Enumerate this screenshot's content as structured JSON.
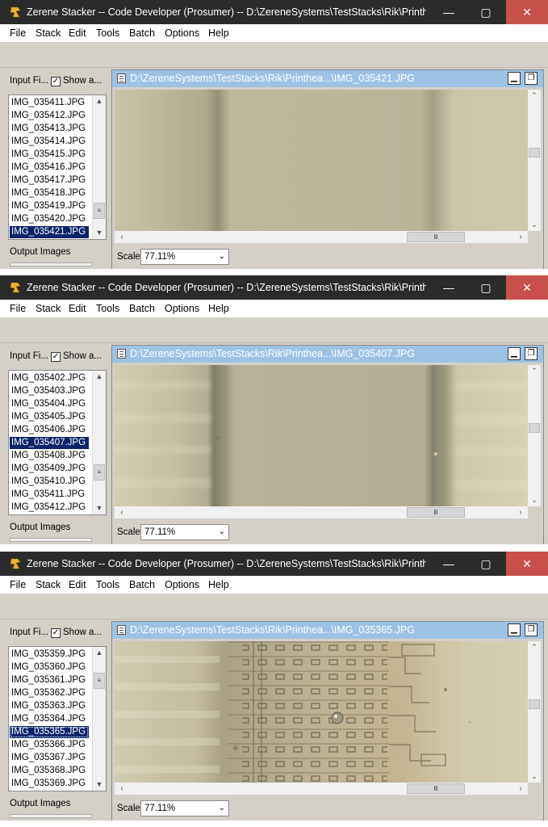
{
  "window_title": "Zerene Stacker -- Code Developer (Prosumer) -- D:\\ZereneSystems\\TestStacks\\Rik\\Printhea......",
  "window_controls": {
    "minimize": "—",
    "maximize": "▢",
    "close": "✕"
  },
  "menu": [
    "File",
    "Stack",
    "Edit",
    "Tools",
    "Batch",
    "Options",
    "Help"
  ],
  "panel": {
    "input_files_label": "Input Fi...",
    "show_all_label": "Show a...",
    "show_all_checked": true,
    "output_images_label": "Output Images",
    "scale_label": "Scale",
    "scale_value": "77.11%"
  },
  "windows": [
    {
      "image_title": "D:\\ZereneSystems\\TestStacks\\Rik\\Printhea...\\IMG_035421.JPG",
      "files": [
        "IMG_035411.JPG",
        "IMG_035412.JPG",
        "IMG_035413.JPG",
        "IMG_035414.JPG",
        "IMG_035415.JPG",
        "IMG_035416.JPG",
        "IMG_035417.JPG",
        "IMG_035418.JPG",
        "IMG_035419.JPG",
        "IMG_035420.JPG",
        "IMG_035421.JPG"
      ],
      "selected": "IMG_035421.JPG"
    },
    {
      "image_title": "D:\\ZereneSystems\\TestStacks\\Rik\\Printhea...\\IMG_035407.JPG",
      "files": [
        "IMG_035402.JPG",
        "IMG_035403.JPG",
        "IMG_035404.JPG",
        "IMG_035405.JPG",
        "IMG_035406.JPG",
        "IMG_035407.JPG",
        "IMG_035408.JPG",
        "IMG_035409.JPG",
        "IMG_035410.JPG",
        "IMG_035411.JPG",
        "IMG_035412.JPG"
      ],
      "selected": "IMG_035407.JPG"
    },
    {
      "image_title": "D:\\ZereneSystems\\TestStacks\\Rik\\Printhea...\\IMG_035365.JPG",
      "files": [
        "IMG_035359.JPG",
        "IMG_035360.JPG",
        "IMG_035361.JPG",
        "IMG_035362.JPG",
        "IMG_035363.JPG",
        "IMG_035364.JPG",
        "IMG_035365.JPG",
        "IMG_035366.JPG",
        "IMG_035367.JPG",
        "IMG_035368.JPG",
        "IMG_035369.JPG"
      ],
      "selected": "IMG_035365.JPG"
    }
  ],
  "colors": {
    "titlebar": "#2b2b2b",
    "close_button": "#c8504b",
    "image_titlebar": "#9cc3e6",
    "selection": "#0a246a",
    "panel_bg": "#d4d0c8"
  }
}
